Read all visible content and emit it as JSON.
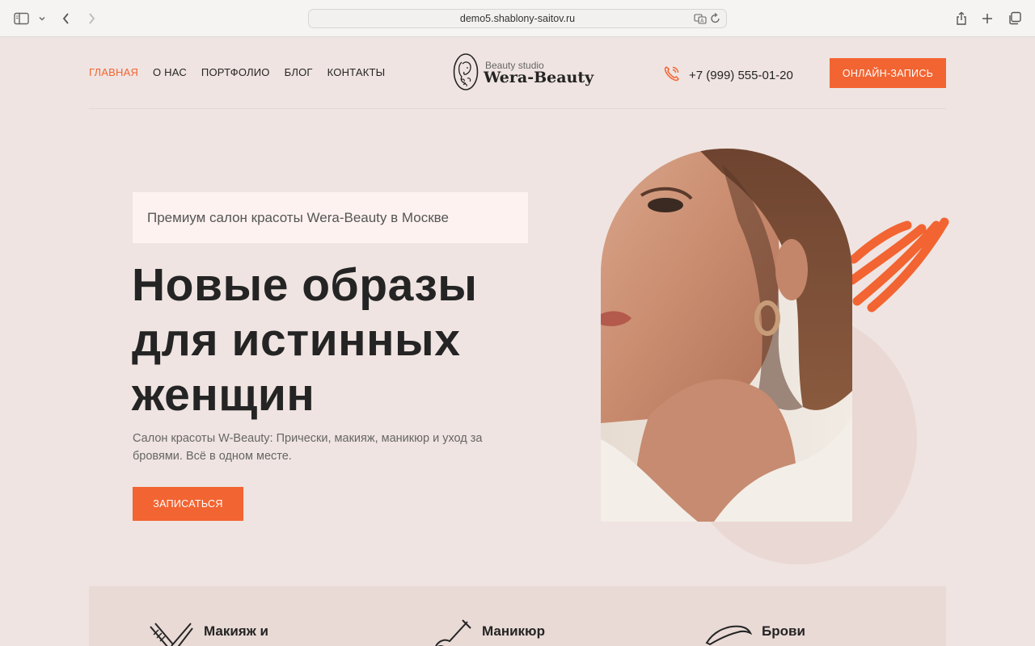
{
  "browser": {
    "url": "demo5.shablony-saitov.ru"
  },
  "nav": {
    "items": [
      {
        "label": "ГЛАВНАЯ",
        "active": true
      },
      {
        "label": "О НАС"
      },
      {
        "label": "ПОРТФОЛИО"
      },
      {
        "label": "БЛОГ"
      },
      {
        "label": "КОНТАКТЫ"
      }
    ]
  },
  "logo": {
    "subtitle": "Beauty studio",
    "title": "Wera-Beauty"
  },
  "contact": {
    "phone": "+7 (999) 555-01-20"
  },
  "header": {
    "cta_label": "ОНЛАЙН-ЗАПИСЬ"
  },
  "hero": {
    "tagline": "Премиум салон красоты Wera-Beauty в Москве",
    "headline_lines": [
      "Новые образы",
      "для истинных",
      "женщин"
    ],
    "description": "Салон красоты W-Beauty: Прически, макияж, маникюр и уход за бровями. Всё в одном месте.",
    "cta_label": "ЗАПИСАТЬСЯ"
  },
  "services": [
    {
      "label": "Макияж и",
      "icon": "makeup-brush-icon"
    },
    {
      "label": "Маникюр",
      "icon": "nail-brush-icon"
    },
    {
      "label": "Брови",
      "icon": "eyebrow-icon"
    }
  ],
  "colors": {
    "accent": "#f26432",
    "background": "#efe4e1",
    "tagline_bg": "#fdf2f0",
    "text": "#242424"
  }
}
